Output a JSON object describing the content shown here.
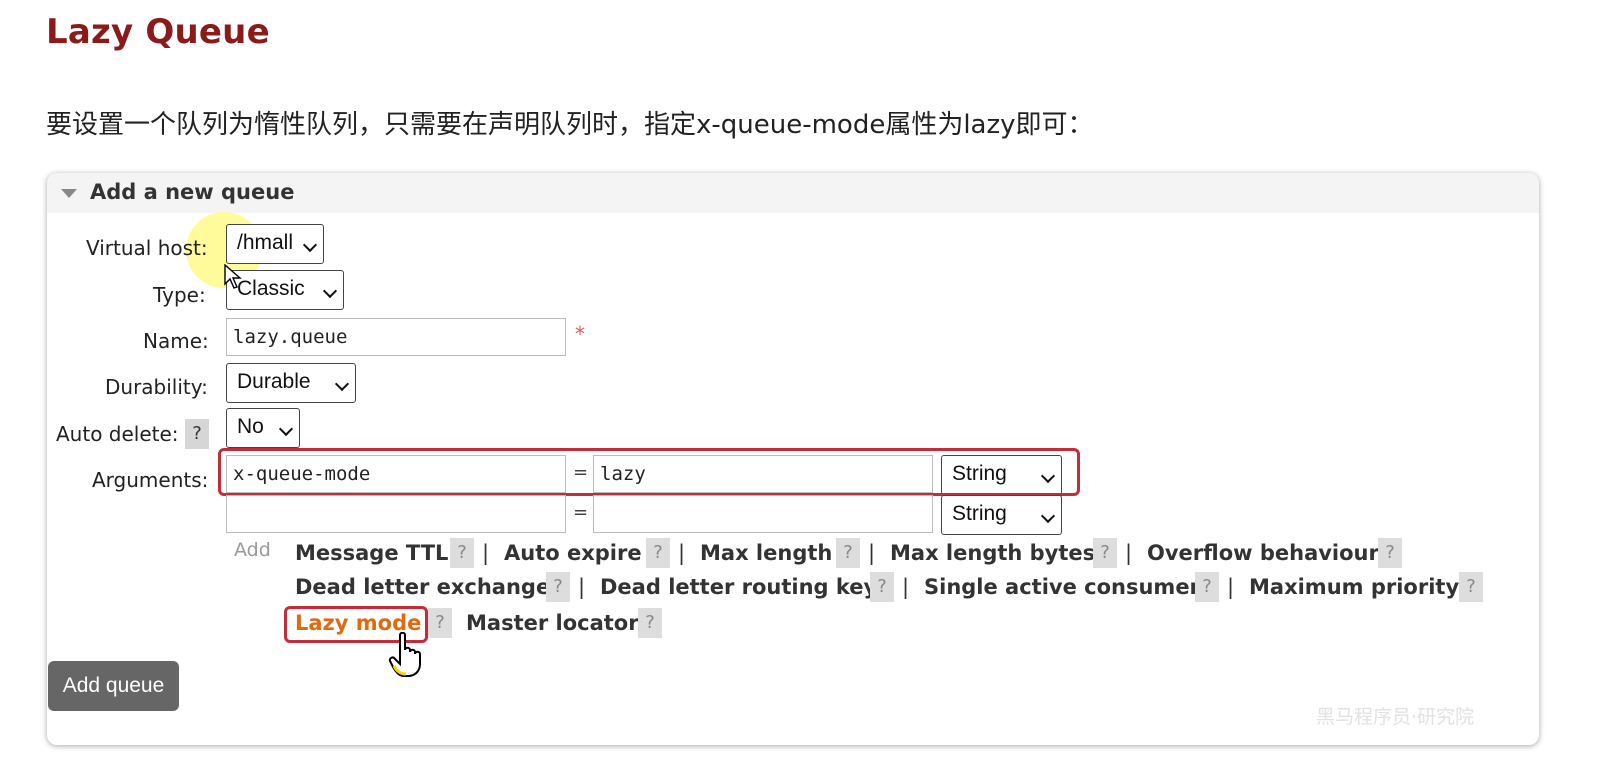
{
  "slide": {
    "title": "Lazy Queue",
    "instruction": "要设置一个队列为惰性队列，只需要在声明队列时，指定x-queue-mode属性为lazy即可："
  },
  "panel": {
    "title": "Add a new queue"
  },
  "form": {
    "virtual_host": {
      "label": "Virtual host:",
      "value": "/hmall"
    },
    "type": {
      "label": "Type:",
      "value": "Classic"
    },
    "name": {
      "label": "Name:",
      "value": "lazy.queue",
      "required_mark": "*"
    },
    "durability": {
      "label": "Durability:",
      "value": "Durable"
    },
    "auto_delete": {
      "label": "Auto delete:",
      "help": "?",
      "value": "No"
    },
    "arguments": {
      "label": "Arguments:",
      "rows": [
        {
          "key": "x-queue-mode",
          "equals": "=",
          "value": "lazy",
          "type": "String"
        },
        {
          "key": "",
          "equals": "=",
          "value": "",
          "type": "String"
        }
      ]
    }
  },
  "add_links": {
    "add_label": "Add",
    "help": "?",
    "separator": "|",
    "items": [
      "Message TTL",
      "Auto expire",
      "Max length",
      "Max length bytes",
      "Overflow behaviour",
      "Dead letter exchange",
      "Dead letter routing key",
      "Single active consumer",
      "Maximum priority",
      "Lazy mode",
      "Master locator"
    ]
  },
  "buttons": {
    "add_queue": "Add queue"
  },
  "watermark": "黑马程序员·研究院",
  "colors": {
    "title": "#8b1a1a",
    "highlight_border": "#c22d3a",
    "lazy_link": "#e06a10",
    "button_bg": "#666666"
  },
  "icons": [
    "collapse-triangle-icon",
    "chevron-down-icon",
    "hand-pointer-icon",
    "arrow-cursor-icon"
  ]
}
